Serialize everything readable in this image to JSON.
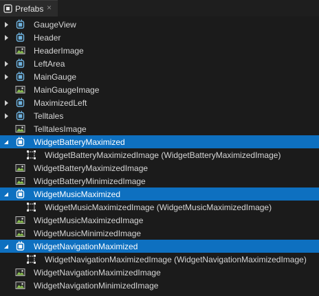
{
  "panel": {
    "tab_title": "Prefabs",
    "close_glyph": "×"
  },
  "tree": [
    {
      "label": "GaugeView",
      "icon": "node-icon",
      "expander": "collapsed",
      "level": 0,
      "selected": false
    },
    {
      "label": "Header",
      "icon": "node-icon",
      "expander": "collapsed",
      "level": 0,
      "selected": false
    },
    {
      "label": "HeaderImage",
      "icon": "image-icon",
      "expander": "none",
      "level": 0,
      "selected": false
    },
    {
      "label": "LeftArea",
      "icon": "node-icon",
      "expander": "collapsed",
      "level": 0,
      "selected": false
    },
    {
      "label": "MainGauge",
      "icon": "node-icon",
      "expander": "collapsed",
      "level": 0,
      "selected": false
    },
    {
      "label": "MainGaugeImage",
      "icon": "image-icon",
      "expander": "none",
      "level": 0,
      "selected": false
    },
    {
      "label": "MaximizedLeft",
      "icon": "node-icon",
      "expander": "collapsed",
      "level": 0,
      "selected": false
    },
    {
      "label": "Telltales",
      "icon": "node-icon",
      "expander": "collapsed",
      "level": 0,
      "selected": false
    },
    {
      "label": "TelltalesImage",
      "icon": "image-icon",
      "expander": "none",
      "level": 0,
      "selected": false
    },
    {
      "label": "WidgetBatteryMaximized",
      "icon": "node-icon",
      "expander": "expanded",
      "level": 0,
      "selected": true
    },
    {
      "label": "WidgetBatteryMaximizedImage (WidgetBatteryMaximizedImage)",
      "icon": "image-placeholder-icon",
      "expander": "none",
      "level": 1,
      "selected": false
    },
    {
      "label": "WidgetBatteryMaximizedImage",
      "icon": "image-icon",
      "expander": "none",
      "level": 0,
      "selected": false
    },
    {
      "label": "WidgetBatteryMinimizedImage",
      "icon": "image-icon",
      "expander": "none",
      "level": 0,
      "selected": false
    },
    {
      "label": "WidgetMusicMaximized",
      "icon": "node-icon",
      "expander": "expanded",
      "level": 0,
      "selected": true
    },
    {
      "label": "WidgetMusicMaximizedImage (WidgetMusicMaximizedImage)",
      "icon": "image-placeholder-icon",
      "expander": "none",
      "level": 1,
      "selected": false
    },
    {
      "label": "WidgetMusicMaximizedImage",
      "icon": "image-icon",
      "expander": "none",
      "level": 0,
      "selected": false
    },
    {
      "label": "WidgetMusicMinimizedImage",
      "icon": "image-icon",
      "expander": "none",
      "level": 0,
      "selected": false
    },
    {
      "label": "WidgetNavigationMaximized",
      "icon": "node-icon",
      "expander": "expanded",
      "level": 0,
      "selected": true
    },
    {
      "label": "WidgetNavigationMaximizedImage (WidgetNavigationMaximizedImage)",
      "icon": "image-placeholder-icon",
      "expander": "none",
      "level": 1,
      "selected": false
    },
    {
      "label": "WidgetNavigationMaximizedImage",
      "icon": "image-icon",
      "expander": "none",
      "level": 0,
      "selected": false
    },
    {
      "label": "WidgetNavigationMinimizedImage",
      "icon": "image-icon",
      "expander": "none",
      "level": 0,
      "selected": false
    }
  ],
  "colors": {
    "background": "#1b1b1b",
    "selection": "#0e70c0",
    "text": "#d6d6d6",
    "node_icon": "#6fb3e0",
    "image_icon": "#8cc152"
  }
}
